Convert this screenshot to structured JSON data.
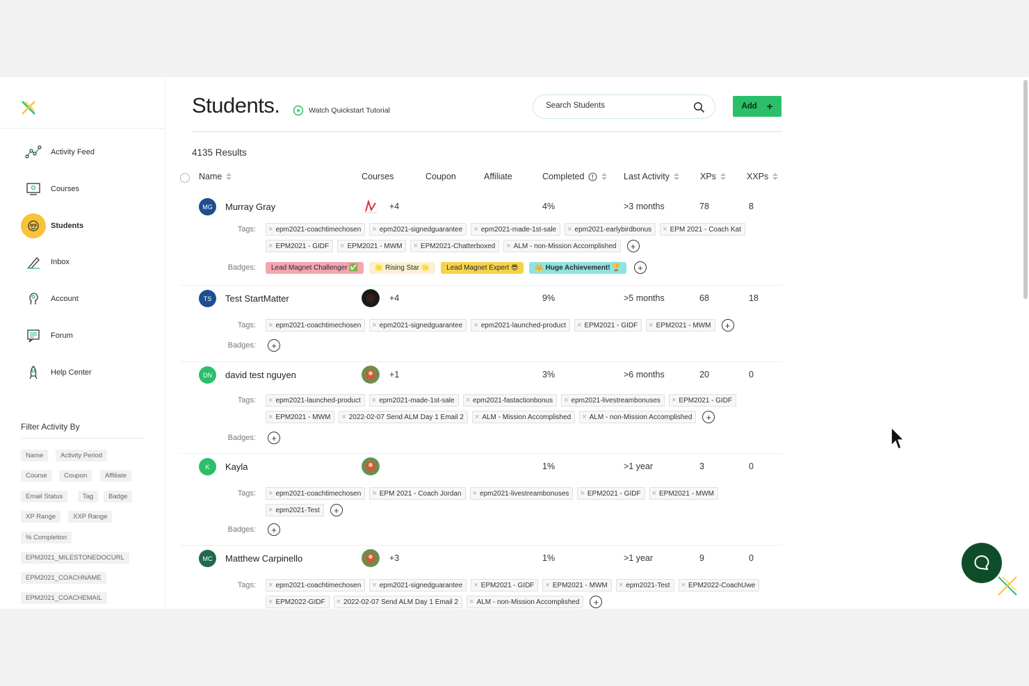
{
  "sidebar": {
    "nav": [
      {
        "label": "Activity Feed",
        "icon": "activity-feed-icon"
      },
      {
        "label": "Courses",
        "icon": "courses-icon"
      },
      {
        "label": "Students",
        "icon": "students-icon",
        "active": true
      },
      {
        "label": "Inbox",
        "icon": "inbox-icon"
      },
      {
        "label": "Account",
        "icon": "account-icon"
      },
      {
        "label": "Forum",
        "icon": "forum-icon"
      },
      {
        "label": "Help Center",
        "icon": "help-center-icon"
      }
    ],
    "filter_title": "Filter Activity By",
    "filters": [
      "Name",
      "Activity Period",
      "Course",
      "Coupon",
      "Affiliate",
      "Email Status",
      "Tag",
      "Badge",
      "XP Range",
      "XXP Range",
      "% Completion",
      "EPM2021_MILESTONEDOCURL",
      "EPM2021_COACHNAME",
      "EPM2021_COACHEMAIL"
    ]
  },
  "header": {
    "title": "Students.",
    "quickstart": "Watch Quickstart Tutorial",
    "search_placeholder": "Search Students",
    "add_label": "Add"
  },
  "results": "4135 Results",
  "columns": {
    "name": "Name",
    "courses": "Courses",
    "coupon": "Coupon",
    "affiliate": "Affiliate",
    "completed": "Completed",
    "last_activity": "Last Activity",
    "xps": "XPs",
    "xxps": "XXPs"
  },
  "labels": {
    "tags": "Tags:",
    "badges": "Badges:"
  },
  "students": [
    {
      "initials": "MG",
      "name": "Murray Gray",
      "avatar_color": "#1d4e8f",
      "extra_courses": "+4",
      "completed": "4%",
      "last_activity": ">3 months",
      "xps": "78",
      "xxps": "8",
      "tags": [
        "epm2021-coachtimechosen",
        "epm2021-signedguarantee",
        "epm2021-made-1st-sale",
        "epm2021-earlybirdbonus",
        "EPM 2021 - Coach Kat",
        "EPM2021 - GIDF",
        "EPM2021 - MWM",
        "EPM2021-Chatterboxed",
        "ALM - non-Mission Accomplished"
      ],
      "badges": [
        {
          "label": "Lead Magnet Challenger ✅",
          "bg": "#f3a6b0"
        },
        {
          "label": "🌟 Rising Star 🌟",
          "bg": "#fbf0d3"
        },
        {
          "label": "Lead Magnet Expert 😎",
          "bg": "#f5d24a"
        },
        {
          "label": "👑 Huge Achievement! 🏆",
          "bg": "#8fe3e0"
        }
      ]
    },
    {
      "initials": "TS",
      "name": "Test StartMatter",
      "avatar_color": "#1d4e8f",
      "extra_courses": "+4",
      "completed": "9%",
      "last_activity": ">5 months",
      "xps": "68",
      "xxps": "18",
      "tags": [
        "epm2021-coachtimechosen",
        "epm2021-signedguarantee",
        "epm2021-launched-product",
        "EPM2021 - GIDF",
        "EPM2021 - MWM"
      ],
      "badges": []
    },
    {
      "initials": "DN",
      "name": "david test nguyen",
      "avatar_color": "#2bbf6a",
      "extra_courses": "+1",
      "completed": "3%",
      "last_activity": ">6 months",
      "xps": "20",
      "xxps": "0",
      "tags": [
        "epm2021-launched-product",
        "epm2021-made-1st-sale",
        "epm2021-fastactionbonus",
        "epm2021-livestreambonuses",
        "EPM2021 - GIDF",
        "EPM2021 - MWM",
        "2022-02-07 Send ALM Day 1 Email 2",
        "ALM - Mission Accomplished",
        "ALM - non-Mission Accomplished"
      ],
      "badges": []
    },
    {
      "initials": "K",
      "name": "Kayla",
      "avatar_color": "#2bbf6a",
      "extra_courses": "",
      "completed": "1%",
      "last_activity": ">1 year",
      "xps": "3",
      "xxps": "0",
      "tags": [
        "epm2021-coachtimechosen",
        "EPM 2021 - Coach Jordan",
        "epm2021-livestreambonuses",
        "EPM2021 - GIDF",
        "EPM2021 - MWM",
        "epm2021-Test"
      ],
      "badges": []
    },
    {
      "initials": "MC",
      "name": "Matthew Carpinello",
      "avatar_color": "#1f6b4a",
      "extra_courses": "+3",
      "completed": "1%",
      "last_activity": ">1 year",
      "xps": "9",
      "xxps": "0",
      "tags": [
        "epm2021-coachtimechosen",
        "epm2021-signedguarantee",
        "EPM2021 - GIDF",
        "EPM2021 - MWM",
        "epm2021-Test",
        "EPM2022-CoachUwe",
        "EPM2022-GIDF",
        "2022-02-07 Send ALM Day 1 Email 2",
        "ALM - non-Mission Accomplished"
      ],
      "badges": []
    }
  ]
}
